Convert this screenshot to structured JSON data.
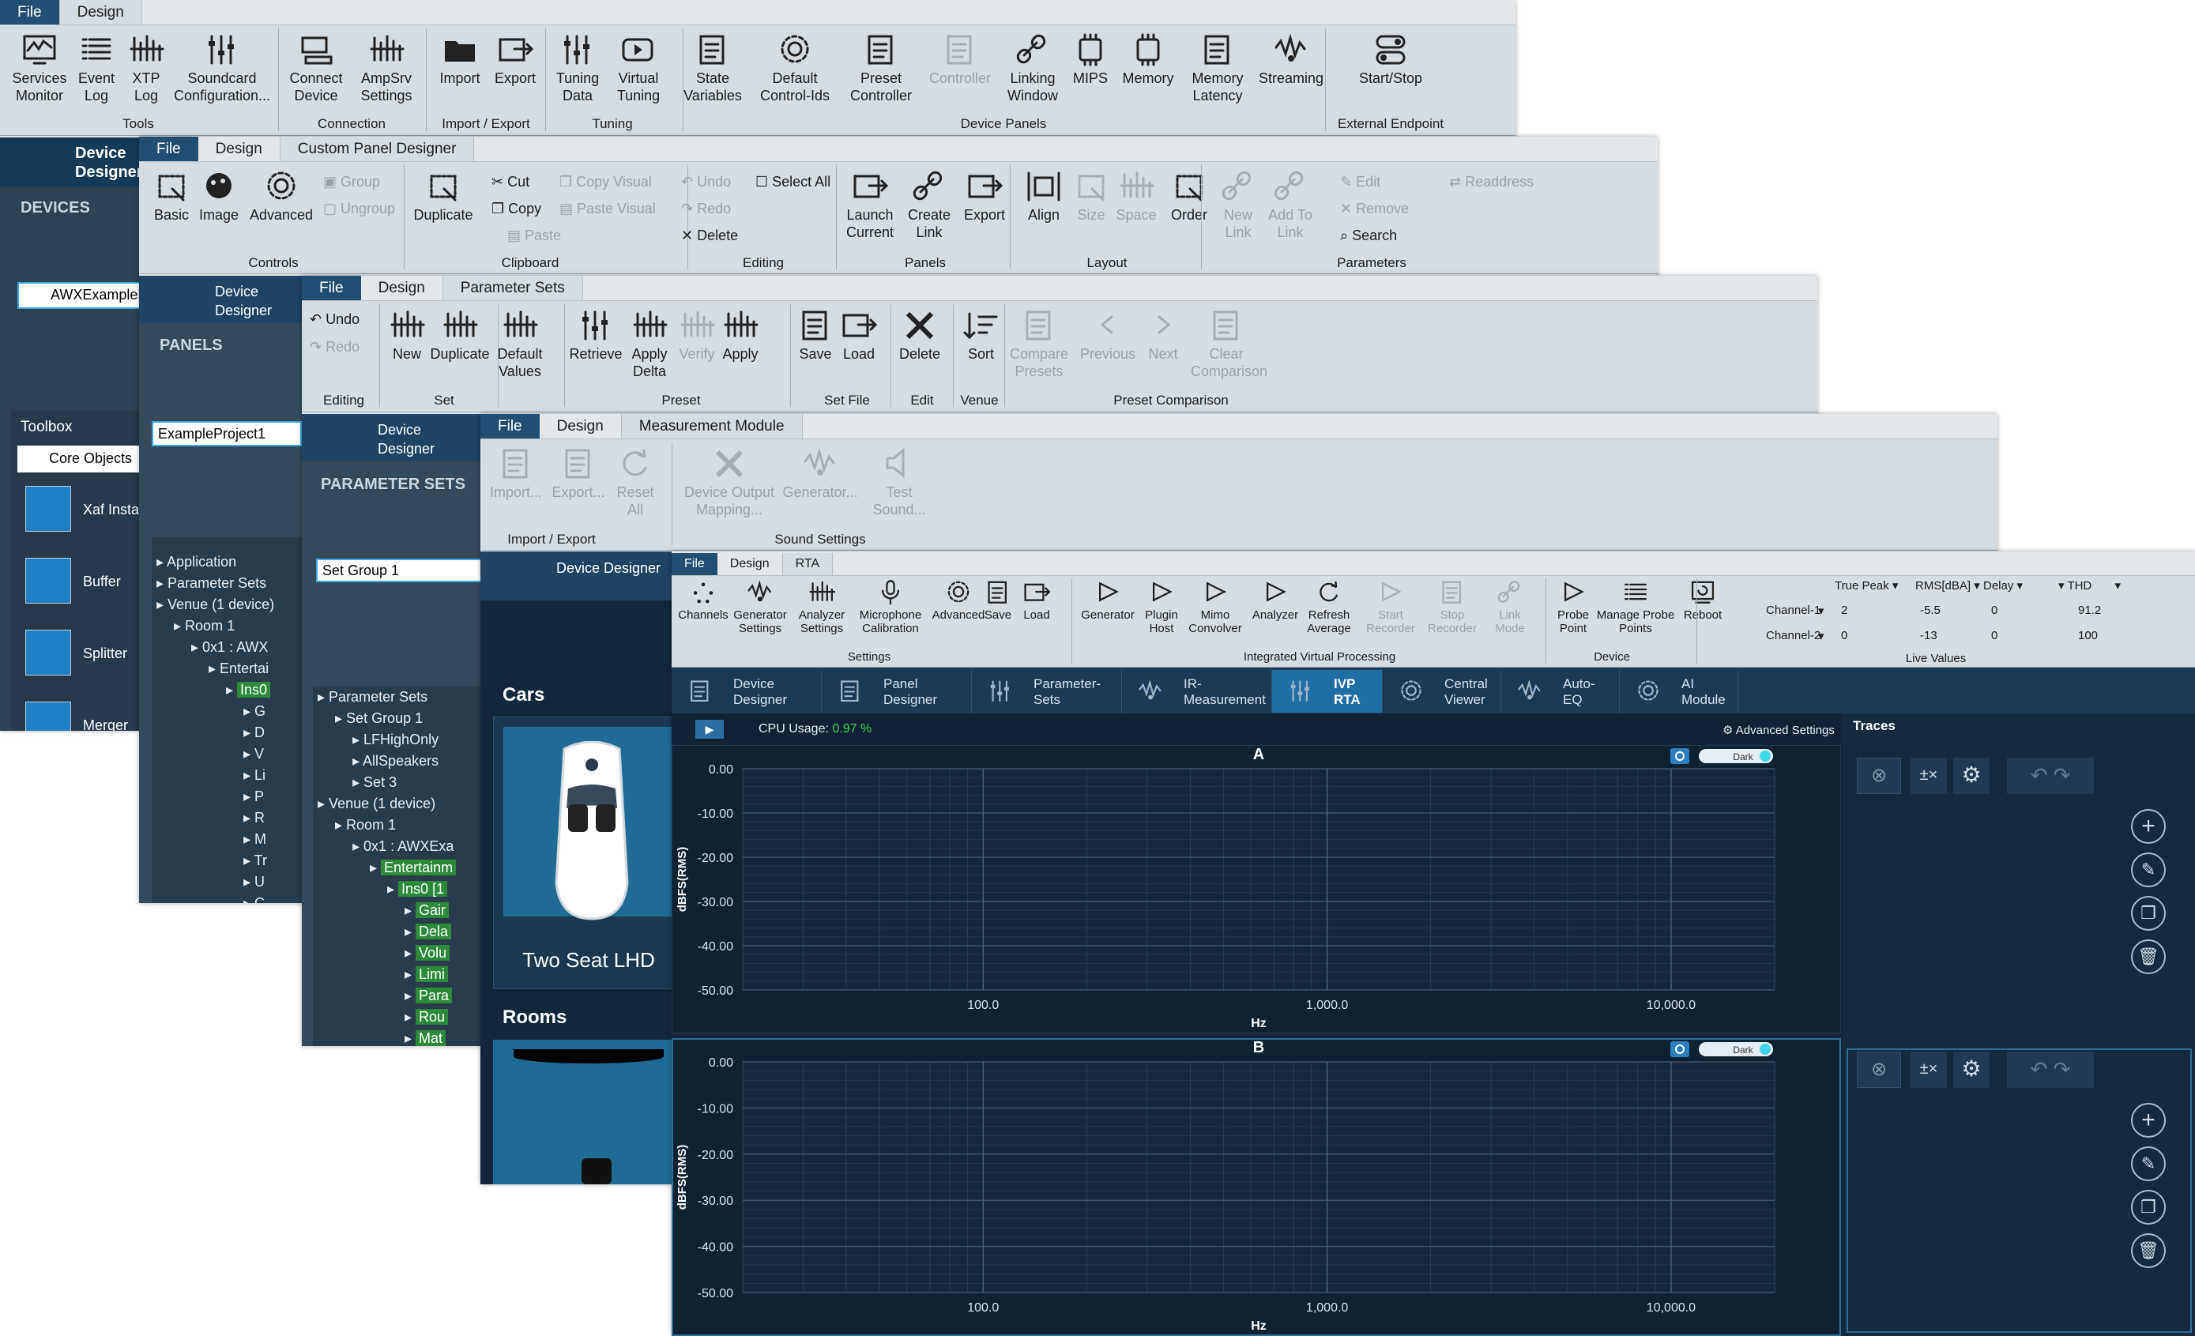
{
  "win1": {
    "tabs": [
      "File",
      "Design"
    ],
    "buttons": [
      [
        "Services",
        "Monitor"
      ],
      [
        "Event",
        "Log"
      ],
      [
        "XTP",
        "Log"
      ],
      [
        "Soundcard",
        "Configuration..."
      ],
      [
        "Connect",
        "Device"
      ],
      [
        "AmpSrv",
        "Settings"
      ],
      [
        "Import",
        ""
      ],
      [
        "Export",
        ""
      ],
      [
        "Tuning",
        "Data"
      ],
      [
        "Virtual",
        "Tuning"
      ],
      [
        "State",
        "Variables"
      ],
      [
        "Default",
        "Control-Ids"
      ],
      [
        "Preset",
        "Controller"
      ],
      [
        "Controller",
        ""
      ],
      [
        "Linking",
        "Window"
      ],
      [
        "MIPS",
        ""
      ],
      [
        "Memory",
        ""
      ],
      [
        "Memory",
        "Latency"
      ],
      [
        "Streaming",
        ""
      ],
      [
        "Start/Stop",
        ""
      ]
    ],
    "groups": [
      "Tools",
      "Connection",
      "Import / Export",
      "Tuning",
      "Device Panels",
      "External Endpoint"
    ],
    "device_designer": "Device Designer",
    "devices_header": "DEVICES",
    "device_item": "AWXExampleP",
    "toolbox": "Toolbox",
    "core_objects": "Core Objects",
    "toolbox_items": [
      "Xaf Insta",
      "Buffer",
      "Splitter",
      "Merger"
    ]
  },
  "win2": {
    "tabs": [
      "File",
      "Design",
      "Custom Panel Designer"
    ],
    "buttons": [
      [
        "Basic",
        ""
      ],
      [
        "Image",
        ""
      ],
      [
        "Advanced",
        ""
      ],
      [
        "Duplicate",
        ""
      ],
      [
        "Launch",
        "Current"
      ],
      [
        "Create",
        "Link"
      ],
      [
        "Export",
        ""
      ],
      [
        "Align",
        ""
      ],
      [
        "Size",
        ""
      ],
      [
        "Space",
        ""
      ],
      [
        "Order",
        ""
      ],
      [
        "New",
        "Link"
      ],
      [
        "Add To",
        "Link"
      ]
    ],
    "small": [
      "Group",
      "Ungroup",
      "Cut",
      "Copy",
      "Paste",
      "Copy Visual",
      "Paste Visual",
      "Undo",
      "Redo",
      "Delete",
      "Select All",
      "Edit",
      "Remove",
      "Search",
      "Readdress"
    ],
    "groups": [
      "Controls",
      "Clipboard",
      "Editing",
      "Panels",
      "Layout",
      "Parameters"
    ],
    "device_designer": "Device Designer",
    "panels_header": "PANELS",
    "project": "ExampleProject1",
    "tree": [
      "Application",
      "Parameter Sets",
      "Venue (1 device)",
      "Room 1",
      "0x1 : AWX",
      "Entertai",
      "Ins0",
      "G",
      "D",
      "V",
      "Li",
      "P",
      "R",
      "M",
      "Tr",
      "U",
      "C"
    ]
  },
  "win3": {
    "tabs": [
      "File",
      "Design",
      "Parameter Sets"
    ],
    "small": [
      "Undo",
      "Redo"
    ],
    "buttons": [
      [
        "New",
        ""
      ],
      [
        "Duplicate",
        ""
      ],
      [
        "Default",
        "Values"
      ],
      [
        "Retrieve",
        ""
      ],
      [
        "Apply",
        "Delta"
      ],
      [
        "Verify",
        ""
      ],
      [
        "Apply",
        ""
      ],
      [
        "Save",
        ""
      ],
      [
        "Load",
        ""
      ],
      [
        "Delete",
        ""
      ],
      [
        "Sort",
        ""
      ],
      [
        "Compare",
        "Presets"
      ],
      [
        "Previous",
        ""
      ],
      [
        "Next",
        ""
      ],
      [
        "Clear",
        "Comparison"
      ]
    ],
    "groups": [
      "Editing",
      "Set",
      "Preset",
      "Set File",
      "Edit",
      "Venue",
      "Preset Comparison"
    ],
    "device_designer": "Device Designer",
    "header": "PARAMETER SETS",
    "set_group": "Set Group 1",
    "tree": [
      "Parameter Sets",
      "Set Group 1",
      "LFHighOnly",
      "AllSpeakers",
      "Set 3",
      "Venue (1 device)",
      "Room 1",
      "0x1 : AWXExa",
      "Entertainm",
      "Ins0 [1",
      "Gair",
      "Dela",
      "Volu",
      "Limi",
      "Para",
      "Rou",
      "Mat"
    ]
  },
  "win4": {
    "tabs": [
      "File",
      "Design",
      "Measurement Module"
    ],
    "buttons": [
      [
        "Import...",
        ""
      ],
      [
        "Export...",
        ""
      ],
      [
        "Reset",
        "All"
      ],
      [
        "Device Output",
        "Mapping..."
      ],
      [
        "Generator...",
        ""
      ],
      [
        "Test",
        "Sound..."
      ]
    ],
    "groups": [
      "Import / Export",
      "Sound Settings"
    ],
    "device_designer": "Device Designer",
    "cars": "Cars",
    "car_name": "Two Seat LHD",
    "rooms": "Rooms"
  },
  "win5": {
    "tabs": [
      "File",
      "Design",
      "RTA"
    ],
    "buttons": [
      [
        "Channels",
        ""
      ],
      [
        "Generator",
        "Settings"
      ],
      [
        "Analyzer",
        "Settings"
      ],
      [
        "Microphone",
        "Calibration"
      ],
      [
        "Advanced",
        ""
      ],
      [
        "Save",
        ""
      ],
      [
        "Load",
        ""
      ],
      [
        "Generator",
        ""
      ],
      [
        "Plugin",
        "Host"
      ],
      [
        "Mimo",
        "Convolver"
      ],
      [
        "Analyzer",
        ""
      ],
      [
        "Refresh",
        "Average"
      ],
      [
        "Start",
        "Recorder"
      ],
      [
        "Stop",
        "Recorder"
      ],
      [
        "Link",
        "Mode"
      ],
      [
        "Probe",
        "Point"
      ],
      [
        "Manage Probe",
        "Points"
      ],
      [
        "Reboot",
        ""
      ]
    ],
    "groups": [
      "Settings",
      "Integrated Virtual Processing",
      "Device",
      "Live Values"
    ],
    "live_headers": [
      "True Peak",
      "RMS[dBA]",
      "Delay",
      "THD"
    ],
    "live_rows": [
      [
        "Channel-1",
        "2",
        "-5.5",
        "0",
        "91.2"
      ],
      [
        "Channel-2",
        "0",
        "-13",
        "0",
        "100"
      ]
    ],
    "nav": [
      [
        "Device",
        "Designer"
      ],
      [
        "Panel",
        "Designer"
      ],
      [
        "Parameter-",
        "Sets"
      ],
      [
        "IR-",
        "Measurement"
      ],
      [
        "IVP",
        "RTA"
      ],
      [
        "Central",
        "Viewer"
      ],
      [
        "Auto-",
        "EQ"
      ],
      [
        "AI",
        "Module"
      ]
    ],
    "cpu_label": "CPU Usage:",
    "cpu_value": "0.97 %",
    "advanced_settings": "Advanced Settings",
    "traces": "Traces",
    "toggle": "Dark",
    "accent": "#3fd6e8",
    "cpu_color": "#3cd24f"
  },
  "chart_data": [
    {
      "type": "line",
      "title": "A",
      "xlabel": "Hz",
      "ylabel": "dBFS(RMS)",
      "xscale": "log",
      "xlim": [
        20,
        20000
      ],
      "ylim": [
        -50,
        0
      ],
      "yticks": [
        "0.00",
        "-10.00",
        "-20.00",
        "-30.00",
        "-40.00",
        "-50.00"
      ],
      "xticks": [
        "100.0",
        "1,000.0",
        "10,000.0"
      ],
      "series": []
    },
    {
      "type": "line",
      "title": "B",
      "xlabel": "Hz",
      "ylabel": "dBFS(RMS)",
      "xscale": "log",
      "xlim": [
        20,
        20000
      ],
      "ylim": [
        -50,
        0
      ],
      "yticks": [
        "0.00",
        "-10.00",
        "-20.00",
        "-30.00",
        "-40.00",
        "-50.00"
      ],
      "xticks": [
        "100.0",
        "1,000.0",
        "10,000.0"
      ],
      "series": []
    }
  ]
}
